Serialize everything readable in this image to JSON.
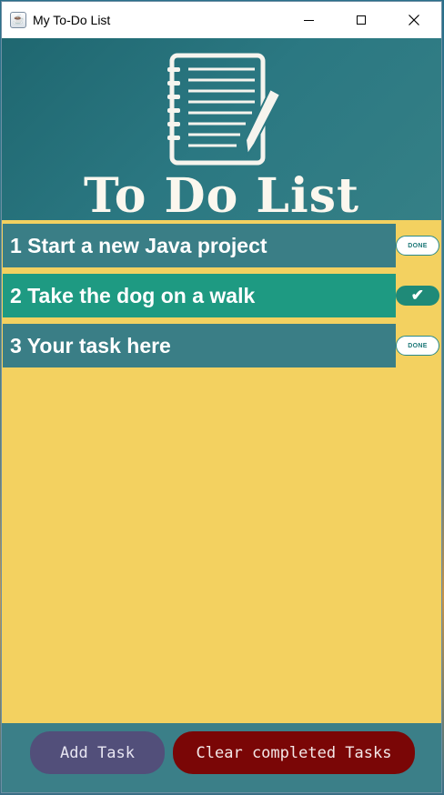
{
  "window": {
    "title": "My To-Do List",
    "app_icon": "java-cup-icon"
  },
  "header": {
    "title": "To Do List",
    "icon": "notebook-pencil-icon"
  },
  "tasks": [
    {
      "label": "1 Start a new Java project",
      "status_label": "DONE",
      "completed": false,
      "row_color": "#3a7e86"
    },
    {
      "label": "2 Take the dog on a walk",
      "status_label": "✔",
      "completed": true,
      "row_color": "#1e9a82"
    },
    {
      "label": "3 Your task here",
      "status_label": "DONE",
      "completed": false,
      "row_color": "#3a7e86"
    }
  ],
  "footer": {
    "add_task_label": "Add Task",
    "clear_label": "Clear completed Tasks"
  },
  "colors": {
    "list_background": "#f3d160",
    "header_teal": "#2b7882",
    "add_button": "#524f7a",
    "clear_button": "#7a0606"
  }
}
